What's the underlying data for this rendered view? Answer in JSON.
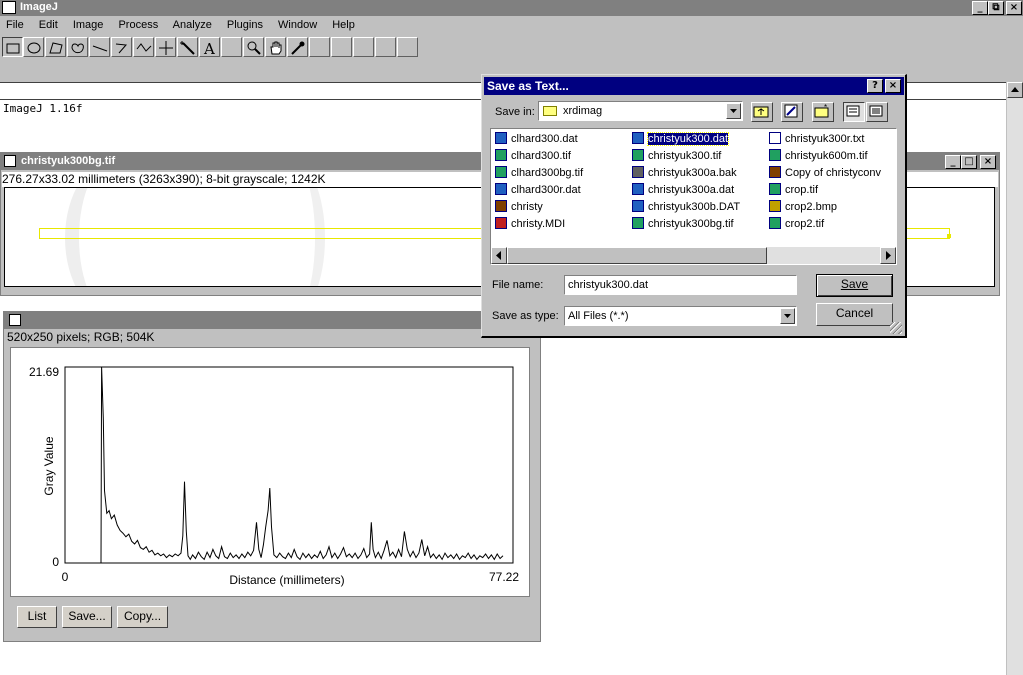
{
  "app": {
    "title": "ImageJ",
    "menu": [
      "File",
      "Edit",
      "Image",
      "Process",
      "Analyze",
      "Plugins",
      "Window",
      "Help"
    ],
    "window_controls": [
      "_",
      "⧉",
      "×"
    ],
    "log_text": "ImageJ 1.16f"
  },
  "image_window": {
    "title": "christyuk300bg.tif",
    "info": "276.27x33.02 millimeters (3263x390); 8-bit grayscale; 1242K"
  },
  "plot_window": {
    "title": "",
    "info": "520x250 pixels; RGB; 504K",
    "buttons": {
      "list": "List",
      "save": "Save...",
      "copy": "Copy..."
    }
  },
  "chart_data": {
    "type": "line",
    "title": "",
    "xlabel": "Distance (millimeters)",
    "ylabel": "Gray Value",
    "xlim": [
      0,
      77.22
    ],
    "ylim": [
      0,
      21.69
    ],
    "x_tick_labels": [
      "0",
      "77.22"
    ],
    "y_tick_labels": [
      "0",
      "21.69"
    ],
    "grid": false,
    "series": [
      {
        "points": [
          [
            6.2,
            0
          ],
          [
            6.3,
            21.69
          ],
          [
            6.6,
            16
          ],
          [
            6.8,
            8
          ],
          [
            7.2,
            5.5
          ],
          [
            7.6,
            5.8
          ],
          [
            8.0,
            4.9
          ],
          [
            8.5,
            5.3
          ],
          [
            9.0,
            4.2
          ],
          [
            9.5,
            3.6
          ],
          [
            10.0,
            3.3
          ],
          [
            10.5,
            2.9
          ],
          [
            11.0,
            3.2
          ],
          [
            11.5,
            2.4
          ],
          [
            12.0,
            2.1
          ],
          [
            12.5,
            2.5
          ],
          [
            13.0,
            1.7
          ],
          [
            13.5,
            1.5
          ],
          [
            14.0,
            1.8
          ],
          [
            14.5,
            1.2
          ],
          [
            15.0,
            1.4
          ],
          [
            15.5,
            0.9
          ],
          [
            16.0,
            1.1
          ],
          [
            16.5,
            0.8
          ],
          [
            17.0,
            1.0
          ],
          [
            17.5,
            0.6
          ],
          [
            18.0,
            0.9
          ],
          [
            18.5,
            0.7
          ],
          [
            19.0,
            1.0
          ],
          [
            19.5,
            0.8
          ],
          [
            20.0,
            1.1
          ],
          [
            20.3,
            3.0
          ],
          [
            20.6,
            9.0
          ],
          [
            20.9,
            3.5
          ],
          [
            21.2,
            0.8
          ],
          [
            21.6,
            0.4
          ],
          [
            22.0,
            0.9
          ],
          [
            22.5,
            0.5
          ],
          [
            23.0,
            1.2
          ],
          [
            23.5,
            0.7
          ],
          [
            24.0,
            0.4
          ],
          [
            24.5,
            1.2
          ],
          [
            25.0,
            0.6
          ],
          [
            25.5,
            1.5
          ],
          [
            26.0,
            0.8
          ],
          [
            26.5,
            0.5
          ],
          [
            27.0,
            1.8
          ],
          [
            27.5,
            0.7
          ],
          [
            28.0,
            0.5
          ],
          [
            28.5,
            1.1
          ],
          [
            29.0,
            0.6
          ],
          [
            29.5,
            0.9
          ],
          [
            30.0,
            0.5
          ],
          [
            30.5,
            1.0
          ],
          [
            31.0,
            0.6
          ],
          [
            31.5,
            1.2
          ],
          [
            32.0,
            0.8
          ],
          [
            32.5,
            1.4
          ],
          [
            33.0,
            4.5
          ],
          [
            33.4,
            1.5
          ],
          [
            33.8,
            0.6
          ],
          [
            34.2,
            2.0
          ],
          [
            34.6,
            4.0
          ],
          [
            35.0,
            5.8
          ],
          [
            35.3,
            8.3
          ],
          [
            35.6,
            4.0
          ],
          [
            36.0,
            0.9
          ],
          [
            36.5,
            0.6
          ],
          [
            37.0,
            1.1
          ],
          [
            37.5,
            0.7
          ],
          [
            38.0,
            0.5
          ],
          [
            38.5,
            1.1
          ],
          [
            39.0,
            0.6
          ],
          [
            39.5,
            1.5
          ],
          [
            40.0,
            0.7
          ],
          [
            40.5,
            0.4
          ],
          [
            41.0,
            1.1
          ],
          [
            41.5,
            0.6
          ],
          [
            42.0,
            1.0
          ],
          [
            42.5,
            0.5
          ],
          [
            43.0,
            0.9
          ],
          [
            43.5,
            0.6
          ],
          [
            44.0,
            1.3
          ],
          [
            44.5,
            0.5
          ],
          [
            45.0,
            0.9
          ],
          [
            45.5,
            1.8
          ],
          [
            46.0,
            0.6
          ],
          [
            46.5,
            1.1
          ],
          [
            47.0,
            0.5
          ],
          [
            47.5,
            1.0
          ],
          [
            48.0,
            1.7
          ],
          [
            48.5,
            0.7
          ],
          [
            49.0,
            1.0
          ],
          [
            49.5,
            0.6
          ],
          [
            50.0,
            1.1
          ],
          [
            50.5,
            0.5
          ],
          [
            51.0,
            0.9
          ],
          [
            51.5,
            1.6
          ],
          [
            52.0,
            0.6
          ],
          [
            52.5,
            1.0
          ],
          [
            52.8,
            4.5
          ],
          [
            53.1,
            1.5
          ],
          [
            53.5,
            0.6
          ],
          [
            54.0,
            1.2
          ],
          [
            54.5,
            0.5
          ],
          [
            55.0,
            1.4
          ],
          [
            55.5,
            2.5
          ],
          [
            56.0,
            0.8
          ],
          [
            56.5,
            1.2
          ],
          [
            57.0,
            0.6
          ],
          [
            57.5,
            1.5
          ],
          [
            58.0,
            0.7
          ],
          [
            58.5,
            3.5
          ],
          [
            59.0,
            1.5
          ],
          [
            59.5,
            0.7
          ],
          [
            60.0,
            1.3
          ],
          [
            60.5,
            0.6
          ],
          [
            61.0,
            1.1
          ],
          [
            61.5,
            2.6
          ],
          [
            62.0,
            0.8
          ],
          [
            62.5,
            1.8
          ],
          [
            63.0,
            0.6
          ],
          [
            63.5,
            1.0
          ],
          [
            64.0,
            0.5
          ],
          [
            64.5,
            0.9
          ],
          [
            65.0,
            0.4
          ],
          [
            65.5,
            1.1
          ],
          [
            66.0,
            0.6
          ],
          [
            66.5,
            0.9
          ],
          [
            67.0,
            0.5
          ],
          [
            67.5,
            1.0
          ],
          [
            68.0,
            0.4
          ],
          [
            68.5,
            0.8
          ],
          [
            69.0,
            0.6
          ],
          [
            69.5,
            1.1
          ],
          [
            70.0,
            0.5
          ],
          [
            70.5,
            0.9
          ],
          [
            71.0,
            0.4
          ],
          [
            71.5,
            0.8
          ],
          [
            72.0,
            0.6
          ],
          [
            72.5,
            1.0
          ],
          [
            73.0,
            0.5
          ],
          [
            73.5,
            0.9
          ],
          [
            74.0,
            0.4
          ],
          [
            74.5,
            1.0
          ],
          [
            75.0,
            0.5
          ],
          [
            75.5,
            0.8
          ]
        ]
      }
    ]
  },
  "dialog": {
    "title": "Save as Text...",
    "save_in_label": "Save in:",
    "save_in_value": "xrdimag",
    "files": [
      {
        "name": "clhard300.dat",
        "col": 0,
        "row": 0,
        "icon": "dat",
        "selected": false
      },
      {
        "name": "clhard300.tif",
        "col": 0,
        "row": 1,
        "icon": "tif",
        "selected": false
      },
      {
        "name": "clhard300bg.tif",
        "col": 0,
        "row": 2,
        "icon": "tif",
        "selected": false
      },
      {
        "name": "clhard300r.dat",
        "col": 0,
        "row": 3,
        "icon": "dat",
        "selected": false
      },
      {
        "name": "christy",
        "col": 0,
        "row": 4,
        "icon": "app",
        "selected": false
      },
      {
        "name": "christy.MDI",
        "col": 0,
        "row": 5,
        "icon": "mdi",
        "selected": false
      },
      {
        "name": "christyuk300.dat",
        "col": 1,
        "row": 0,
        "icon": "dat",
        "selected": true
      },
      {
        "name": "christyuk300.tif",
        "col": 1,
        "row": 1,
        "icon": "tif",
        "selected": false
      },
      {
        "name": "christyuk300a.bak",
        "col": 1,
        "row": 2,
        "icon": "bak",
        "selected": false
      },
      {
        "name": "christyuk300a.dat",
        "col": 1,
        "row": 3,
        "icon": "dat",
        "selected": false
      },
      {
        "name": "christyuk300b.DAT",
        "col": 1,
        "row": 4,
        "icon": "dat",
        "selected": false
      },
      {
        "name": "christyuk300bg.tif",
        "col": 1,
        "row": 5,
        "icon": "tif",
        "selected": false
      },
      {
        "name": "christyuk300r.txt",
        "col": 2,
        "row": 0,
        "icon": "txt",
        "selected": false
      },
      {
        "name": "christyuk600m.tif",
        "col": 2,
        "row": 1,
        "icon": "tif",
        "selected": false
      },
      {
        "name": "Copy of christyconv",
        "col": 2,
        "row": 2,
        "icon": "app",
        "selected": false
      },
      {
        "name": "crop.tif",
        "col": 2,
        "row": 3,
        "icon": "tif",
        "selected": false
      },
      {
        "name": "crop2.bmp",
        "col": 2,
        "row": 4,
        "icon": "bmp",
        "selected": false
      },
      {
        "name": "crop2.tif",
        "col": 2,
        "row": 5,
        "icon": "tif",
        "selected": false
      }
    ],
    "file_name_label": "File name:",
    "file_name_value": "christyuk300.dat",
    "save_type_label": "Save as type:",
    "save_type_value": "All Files (*.*)",
    "save_button": "Save",
    "cancel_button": "Cancel"
  },
  "colors": {
    "titlebar_active": "#000080",
    "titlebar_inactive": "#808080",
    "face": "#c0c0c0",
    "selection": "#ffff00"
  }
}
